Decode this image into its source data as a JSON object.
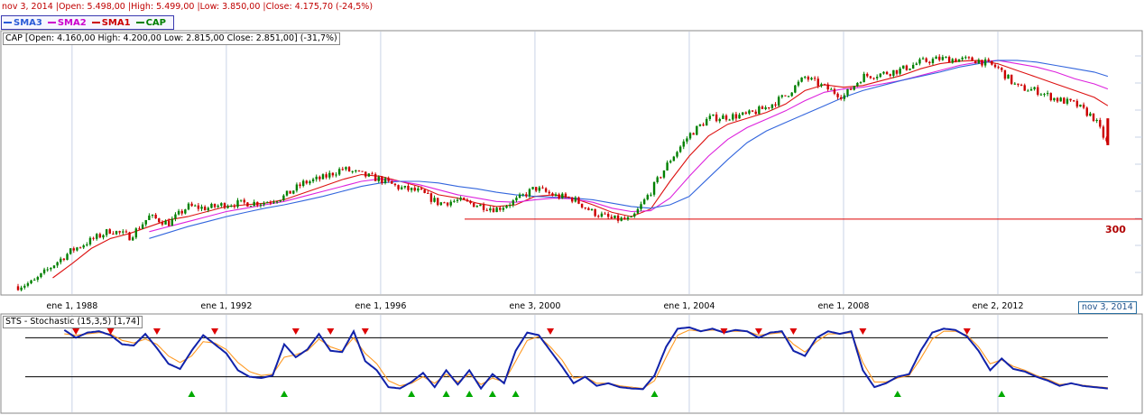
{
  "header": {
    "summary": "nov 3, 2014 |Open: 5.498,00 |High: 5.499,00 |Low: 3.850,00 |Close: 4.175,70 (-24,5%)"
  },
  "legend": [
    {
      "label": "SMA3",
      "color": "#2a5bd7"
    },
    {
      "label": "SMA2",
      "color": "#cc00cc"
    },
    {
      "label": "SMA1",
      "color": "#cc0000"
    },
    {
      "label": "CAP",
      "color": "#008000"
    }
  ],
  "price_panel": {
    "info": "CAP [Open: 4.160,00  High: 4.200,00  Low: 2.815,00  Close: 2.851,00] (-31,7%)",
    "level_label": "300",
    "x_ticks": [
      "ene 1, 1988",
      "ene 1, 1992",
      "ene 1, 1996",
      "ene 3, 2000",
      "ene 1, 2004",
      "ene 1, 2008",
      "ene 2, 2012"
    ],
    "current_date": "nov 3, 2014"
  },
  "stoch_panel": {
    "info": "STS - Stochastic (15,3,5) [1,74]"
  },
  "colors": {
    "up": "#008000",
    "down": "#cc0000",
    "sma1": "#dd1111",
    "sma2": "#dd22dd",
    "sma3": "#3366dd",
    "stoch_k": "#1122aa",
    "stoch_d": "#ff9922",
    "buy_marker": "#00aa00",
    "sell_marker": "#dd0000"
  },
  "chart_data": [
    {
      "type": "line",
      "x_range": [
        1986.6,
        2014.9
      ],
      "x_ticks": [
        1988,
        1992,
        1996,
        2000,
        2004,
        2008,
        2012
      ],
      "x": [
        1986.6,
        1987.0,
        1987.5,
        1988.0,
        1988.5,
        1989.0,
        1989.5,
        1990.0,
        1990.5,
        1991.0,
        1991.5,
        1992.0,
        1992.5,
        1993.0,
        1993.5,
        1994.0,
        1994.5,
        1995.0,
        1995.5,
        1996.0,
        1996.5,
        1997.0,
        1997.5,
        1998.0,
        1998.5,
        1999.0,
        1999.5,
        2000.0,
        2000.5,
        2001.0,
        2001.5,
        2002.0,
        2002.5,
        2003.0,
        2003.5,
        2004.0,
        2004.5,
        2005.0,
        2005.5,
        2006.0,
        2006.5,
        2007.0,
        2007.5,
        2008.0,
        2008.5,
        2009.0,
        2009.5,
        2010.0,
        2010.5,
        2011.0,
        2011.5,
        2012.0,
        2012.5,
        2013.0,
        2013.5,
        2014.0,
        2014.5,
        2014.85
      ],
      "series": [
        {
          "name": "CAP",
          "values": [
            0.05,
            0.1,
            0.3,
            0.48,
            0.6,
            0.72,
            0.64,
            0.88,
            0.8,
            1.0,
            0.98,
            1.03,
            1.04,
            1.05,
            1.12,
            1.28,
            1.34,
            1.45,
            1.38,
            1.32,
            1.22,
            1.18,
            1.04,
            1.07,
            1.02,
            0.97,
            1.07,
            1.22,
            1.13,
            1.09,
            0.93,
            0.85,
            0.84,
            1.18,
            1.55,
            1.85,
            2.05,
            2.07,
            2.09,
            2.18,
            2.32,
            2.54,
            2.42,
            2.31,
            2.55,
            2.58,
            2.63,
            2.72,
            2.76,
            2.75,
            2.74,
            2.65,
            2.42,
            2.38,
            2.28,
            2.22,
            2.05,
            1.73
          ]
        },
        {
          "name": "SMA1",
          "values": [
            null,
            null,
            0.15,
            0.32,
            0.5,
            0.62,
            0.68,
            0.76,
            0.84,
            0.88,
            0.94,
            1.0,
            1.02,
            1.04,
            1.08,
            1.16,
            1.24,
            1.32,
            1.38,
            1.36,
            1.3,
            1.24,
            1.14,
            1.1,
            1.04,
            1.0,
            1.02,
            1.12,
            1.14,
            1.1,
            1.02,
            0.93,
            0.88,
            0.97,
            1.3,
            1.6,
            1.84,
            1.98,
            2.05,
            2.12,
            2.22,
            2.38,
            2.45,
            2.42,
            2.44,
            2.5,
            2.56,
            2.64,
            2.7,
            2.73,
            2.74,
            2.7,
            2.62,
            2.54,
            2.46,
            2.38,
            2.3,
            2.2
          ]
        },
        {
          "name": "SMA2",
          "values": [
            null,
            null,
            null,
            null,
            null,
            null,
            null,
            0.7,
            0.76,
            0.82,
            0.88,
            0.94,
            0.98,
            1.02,
            1.06,
            1.12,
            1.18,
            1.24,
            1.3,
            1.33,
            1.3,
            1.26,
            1.2,
            1.14,
            1.1,
            1.06,
            1.05,
            1.08,
            1.1,
            1.09,
            1.05,
            0.98,
            0.94,
            0.95,
            1.1,
            1.36,
            1.6,
            1.8,
            1.94,
            2.04,
            2.14,
            2.26,
            2.36,
            2.4,
            2.42,
            2.46,
            2.5,
            2.56,
            2.62,
            2.68,
            2.72,
            2.74,
            2.7,
            2.66,
            2.6,
            2.52,
            2.46,
            2.4
          ]
        },
        {
          "name": "SMA3",
          "values": [
            null,
            null,
            null,
            null,
            null,
            null,
            null,
            0.62,
            0.69,
            0.76,
            0.82,
            0.88,
            0.93,
            0.98,
            1.02,
            1.07,
            1.12,
            1.18,
            1.24,
            1.28,
            1.3,
            1.3,
            1.28,
            1.24,
            1.21,
            1.17,
            1.14,
            1.12,
            1.11,
            1.1,
            1.08,
            1.04,
            1.0,
            0.98,
            1.02,
            1.12,
            1.34,
            1.56,
            1.76,
            1.9,
            2.0,
            2.1,
            2.2,
            2.3,
            2.38,
            2.44,
            2.5,
            2.55,
            2.6,
            2.66,
            2.7,
            2.74,
            2.74,
            2.72,
            2.68,
            2.64,
            2.6,
            2.55
          ]
        }
      ],
      "y_range": [
        0,
        2.9
      ],
      "reference_level": 0.85
    },
    {
      "type": "line",
      "x_range": [
        1986.6,
        2014.9
      ],
      "y_range": [
        0,
        100
      ],
      "bands": [
        20,
        80
      ],
      "x": [
        1987.8,
        1988.1,
        1988.4,
        1988.7,
        1989.0,
        1989.3,
        1989.6,
        1989.9,
        1990.2,
        1990.5,
        1990.8,
        1991.1,
        1991.4,
        1991.7,
        1992.0,
        1992.3,
        1992.6,
        1992.9,
        1993.2,
        1993.5,
        1993.8,
        1994.1,
        1994.4,
        1994.7,
        1995.0,
        1995.3,
        1995.6,
        1995.9,
        1996.2,
        1996.5,
        1996.8,
        1997.1,
        1997.4,
        1997.7,
        1998.0,
        1998.3,
        1998.6,
        1998.9,
        1999.2,
        1999.5,
        1999.8,
        2000.1,
        2000.4,
        2000.7,
        2001.0,
        2001.3,
        2001.6,
        2001.9,
        2002.2,
        2002.5,
        2002.8,
        2003.1,
        2003.4,
        2003.7,
        2004.0,
        2004.3,
        2004.6,
        2004.9,
        2005.2,
        2005.5,
        2005.8,
        2006.1,
        2006.4,
        2006.7,
        2007.0,
        2007.3,
        2007.6,
        2007.9,
        2008.2,
        2008.5,
        2008.8,
        2009.1,
        2009.4,
        2009.7,
        2010.0,
        2010.3,
        2010.6,
        2010.9,
        2011.2,
        2011.5,
        2011.8,
        2012.1,
        2012.4,
        2012.7,
        2013.0,
        2013.3,
        2013.6,
        2013.9,
        2014.2,
        2014.5,
        2014.85
      ],
      "series": [
        {
          "name": "K",
          "values": [
            92,
            80,
            88,
            90,
            84,
            70,
            68,
            86,
            64,
            40,
            32,
            60,
            84,
            70,
            56,
            30,
            20,
            18,
            22,
            70,
            50,
            62,
            86,
            60,
            58,
            90,
            44,
            30,
            4,
            2,
            12,
            26,
            4,
            30,
            8,
            30,
            2,
            24,
            10,
            60,
            88,
            84,
            60,
            36,
            10,
            20,
            6,
            10,
            4,
            2,
            1,
            22,
            66,
            94,
            96,
            90,
            94,
            88,
            92,
            90,
            80,
            88,
            90,
            60,
            52,
            80,
            90,
            86,
            90,
            30,
            4,
            10,
            20,
            24,
            60,
            88,
            94,
            92,
            82,
            60,
            30,
            48,
            32,
            28,
            20,
            14,
            6,
            10,
            6,
            4,
            2
          ]
        },
        {
          "name": "D",
          "values": [
            86,
            84,
            86,
            88,
            86,
            76,
            72,
            78,
            70,
            52,
            42,
            52,
            74,
            72,
            62,
            42,
            28,
            22,
            24,
            50,
            54,
            60,
            78,
            66,
            60,
            80,
            56,
            40,
            14,
            6,
            10,
            20,
            10,
            24,
            12,
            24,
            8,
            18,
            12,
            44,
            76,
            82,
            66,
            46,
            18,
            20,
            10,
            10,
            6,
            4,
            2,
            14,
            50,
            84,
            92,
            90,
            92,
            90,
            90,
            90,
            84,
            86,
            88,
            70,
            58,
            74,
            86,
            86,
            88,
            42,
            12,
            12,
            18,
            22,
            48,
            78,
            90,
            90,
            84,
            66,
            40,
            46,
            36,
            30,
            22,
            16,
            8,
            10,
            7,
            5,
            3
          ]
        }
      ]
    }
  ]
}
